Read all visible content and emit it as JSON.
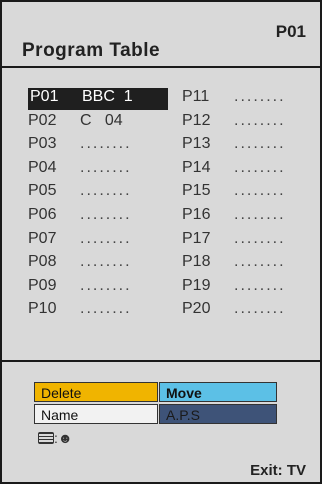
{
  "header": {
    "program_id": "P01",
    "title": "Program Table"
  },
  "programs_left": [
    {
      "num": "P01",
      "name": "BBC  1",
      "selected": true
    },
    {
      "num": "P02",
      "name": "C   04",
      "selected": false
    },
    {
      "num": "P03",
      "name": "........",
      "selected": false
    },
    {
      "num": "P04",
      "name": "........",
      "selected": false
    },
    {
      "num": "P05",
      "name": "........",
      "selected": false
    },
    {
      "num": "P06",
      "name": "........",
      "selected": false
    },
    {
      "num": "P07",
      "name": "........",
      "selected": false
    },
    {
      "num": "P08",
      "name": "........",
      "selected": false
    },
    {
      "num": "P09",
      "name": "........",
      "selected": false
    },
    {
      "num": "P10",
      "name": "........",
      "selected": false
    }
  ],
  "programs_right": [
    {
      "num": "P11",
      "name": "........"
    },
    {
      "num": "P12",
      "name": "........"
    },
    {
      "num": "P13",
      "name": "........"
    },
    {
      "num": "P14",
      "name": "........"
    },
    {
      "num": "P15",
      "name": "........"
    },
    {
      "num": "P16",
      "name": "........"
    },
    {
      "num": "P17",
      "name": "........"
    },
    {
      "num": "P18",
      "name": "........"
    },
    {
      "num": "P19",
      "name": "........"
    },
    {
      "num": "P20",
      "name": "........"
    }
  ],
  "buttons": {
    "delete": "Delete",
    "move": "Move",
    "name": "Name",
    "aps": "A.P.S"
  },
  "icons": {
    "separator": ":"
  },
  "footer": {
    "exit_label": "Exit: TV"
  },
  "colors": {
    "delete": "#f0b400",
    "move": "#5cc0e6",
    "name": "#f2f2f2",
    "aps": "#3e5378",
    "background": "#d9d9d9"
  }
}
